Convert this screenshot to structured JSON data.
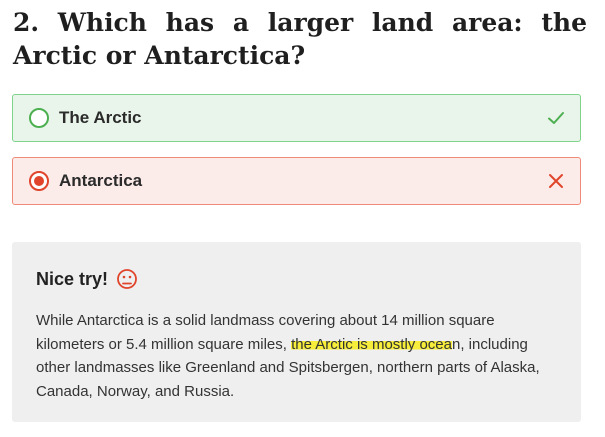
{
  "question": {
    "text": "2. Which has a larger land area: the Arctic or Antarctica?"
  },
  "options": [
    {
      "label": "The Arctic",
      "state": "correct",
      "icon": "check-icon",
      "color": "#4caf50"
    },
    {
      "label": "Antarctica",
      "state": "selected-incorrect",
      "icon": "x-icon",
      "color": "#e0452c"
    }
  ],
  "feedback": {
    "title": "Nice try!",
    "icon": "sad-face-icon",
    "body_before": "While Antarctica is a solid landmass covering about 14 million square kilometers or 5.4 million square miles, ",
    "body_highlight": "the Arctic is mostly ocea",
    "body_after": "n, including other landmasses like Greenland and Spitsbergen, northern parts of Alaska, Canada, Norway, and Russia.",
    "highlight_color": "#f6ee3a"
  }
}
